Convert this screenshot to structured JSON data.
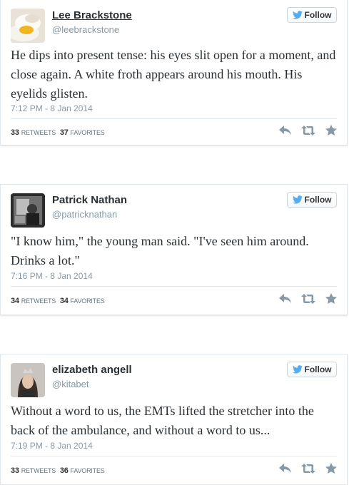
{
  "follow_label": "Follow",
  "tweets": [
    {
      "name": "Lee Brackstone",
      "handle": "@leebrackstone",
      "text": "He dips into present tense: his eyes slit open for a moment, and close again. A white froth appears around his mouth. His eyelids glisten.",
      "time": "7:12 PM - 8 Jan 2014",
      "retweets": "33",
      "favorites": "37",
      "retweets_label": "RETWEETS",
      "favorites_label": "FAVORITES"
    },
    {
      "name": "Patrick Nathan",
      "handle": "@patricknathan",
      "text": "\"I know him,\" the young man said. \"I've seen him around. Drinks a lot.\"",
      "time": "7:16 PM - 8 Jan 2014",
      "retweets": "34",
      "favorites": "34",
      "retweets_label": "RETWEETS",
      "favorites_label": "FAVORITES"
    },
    {
      "name": "elizabeth angell",
      "handle": "@kitabet",
      "text": "Without a word to us, the EMTs lifted the stretcher into the back of the ambulance, and without a word to us...",
      "time": "7:19 PM - 8 Jan 2014",
      "retweets": "33",
      "favorites": "36",
      "retweets_label": "RETWEETS",
      "favorites_label": "FAVORITES"
    }
  ],
  "colors": {
    "twitter_blue": "#55acee",
    "icon_gray": "#8899a6"
  },
  "icons": [
    "bird-icon",
    "reply-icon",
    "retweet-icon",
    "favorite-star-icon"
  ]
}
